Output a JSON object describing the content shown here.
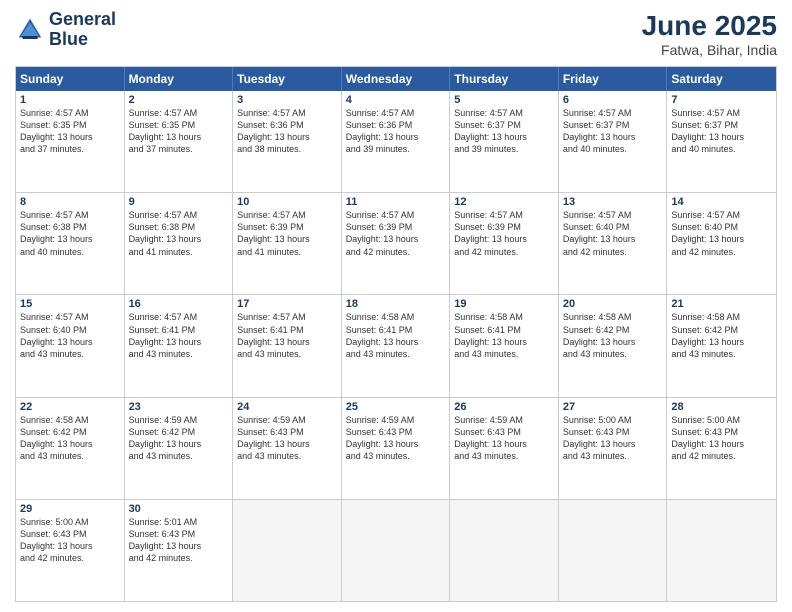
{
  "logo": {
    "line1": "General",
    "line2": "Blue"
  },
  "title": "June 2025",
  "location": "Fatwa, Bihar, India",
  "header_days": [
    "Sunday",
    "Monday",
    "Tuesday",
    "Wednesday",
    "Thursday",
    "Friday",
    "Saturday"
  ],
  "rows": [
    [
      {
        "day": "1",
        "info": "Sunrise: 4:57 AM\nSunset: 6:35 PM\nDaylight: 13 hours\nand 37 minutes."
      },
      {
        "day": "2",
        "info": "Sunrise: 4:57 AM\nSunset: 6:35 PM\nDaylight: 13 hours\nand 37 minutes."
      },
      {
        "day": "3",
        "info": "Sunrise: 4:57 AM\nSunset: 6:36 PM\nDaylight: 13 hours\nand 38 minutes."
      },
      {
        "day": "4",
        "info": "Sunrise: 4:57 AM\nSunset: 6:36 PM\nDaylight: 13 hours\nand 39 minutes."
      },
      {
        "day": "5",
        "info": "Sunrise: 4:57 AM\nSunset: 6:37 PM\nDaylight: 13 hours\nand 39 minutes."
      },
      {
        "day": "6",
        "info": "Sunrise: 4:57 AM\nSunset: 6:37 PM\nDaylight: 13 hours\nand 40 minutes."
      },
      {
        "day": "7",
        "info": "Sunrise: 4:57 AM\nSunset: 6:37 PM\nDaylight: 13 hours\nand 40 minutes."
      }
    ],
    [
      {
        "day": "8",
        "info": "Sunrise: 4:57 AM\nSunset: 6:38 PM\nDaylight: 13 hours\nand 40 minutes."
      },
      {
        "day": "9",
        "info": "Sunrise: 4:57 AM\nSunset: 6:38 PM\nDaylight: 13 hours\nand 41 minutes."
      },
      {
        "day": "10",
        "info": "Sunrise: 4:57 AM\nSunset: 6:39 PM\nDaylight: 13 hours\nand 41 minutes."
      },
      {
        "day": "11",
        "info": "Sunrise: 4:57 AM\nSunset: 6:39 PM\nDaylight: 13 hours\nand 42 minutes."
      },
      {
        "day": "12",
        "info": "Sunrise: 4:57 AM\nSunset: 6:39 PM\nDaylight: 13 hours\nand 42 minutes."
      },
      {
        "day": "13",
        "info": "Sunrise: 4:57 AM\nSunset: 6:40 PM\nDaylight: 13 hours\nand 42 minutes."
      },
      {
        "day": "14",
        "info": "Sunrise: 4:57 AM\nSunset: 6:40 PM\nDaylight: 13 hours\nand 42 minutes."
      }
    ],
    [
      {
        "day": "15",
        "info": "Sunrise: 4:57 AM\nSunset: 6:40 PM\nDaylight: 13 hours\nand 43 minutes."
      },
      {
        "day": "16",
        "info": "Sunrise: 4:57 AM\nSunset: 6:41 PM\nDaylight: 13 hours\nand 43 minutes."
      },
      {
        "day": "17",
        "info": "Sunrise: 4:57 AM\nSunset: 6:41 PM\nDaylight: 13 hours\nand 43 minutes."
      },
      {
        "day": "18",
        "info": "Sunrise: 4:58 AM\nSunset: 6:41 PM\nDaylight: 13 hours\nand 43 minutes."
      },
      {
        "day": "19",
        "info": "Sunrise: 4:58 AM\nSunset: 6:41 PM\nDaylight: 13 hours\nand 43 minutes."
      },
      {
        "day": "20",
        "info": "Sunrise: 4:58 AM\nSunset: 6:42 PM\nDaylight: 13 hours\nand 43 minutes."
      },
      {
        "day": "21",
        "info": "Sunrise: 4:58 AM\nSunset: 6:42 PM\nDaylight: 13 hours\nand 43 minutes."
      }
    ],
    [
      {
        "day": "22",
        "info": "Sunrise: 4:58 AM\nSunset: 6:42 PM\nDaylight: 13 hours\nand 43 minutes."
      },
      {
        "day": "23",
        "info": "Sunrise: 4:59 AM\nSunset: 6:42 PM\nDaylight: 13 hours\nand 43 minutes."
      },
      {
        "day": "24",
        "info": "Sunrise: 4:59 AM\nSunset: 6:43 PM\nDaylight: 13 hours\nand 43 minutes."
      },
      {
        "day": "25",
        "info": "Sunrise: 4:59 AM\nSunset: 6:43 PM\nDaylight: 13 hours\nand 43 minutes."
      },
      {
        "day": "26",
        "info": "Sunrise: 4:59 AM\nSunset: 6:43 PM\nDaylight: 13 hours\nand 43 minutes."
      },
      {
        "day": "27",
        "info": "Sunrise: 5:00 AM\nSunset: 6:43 PM\nDaylight: 13 hours\nand 43 minutes."
      },
      {
        "day": "28",
        "info": "Sunrise: 5:00 AM\nSunset: 6:43 PM\nDaylight: 13 hours\nand 42 minutes."
      }
    ],
    [
      {
        "day": "29",
        "info": "Sunrise: 5:00 AM\nSunset: 6:43 PM\nDaylight: 13 hours\nand 42 minutes."
      },
      {
        "day": "30",
        "info": "Sunrise: 5:01 AM\nSunset: 6:43 PM\nDaylight: 13 hours\nand 42 minutes."
      },
      {
        "day": "",
        "info": ""
      },
      {
        "day": "",
        "info": ""
      },
      {
        "day": "",
        "info": ""
      },
      {
        "day": "",
        "info": ""
      },
      {
        "day": "",
        "info": ""
      }
    ]
  ]
}
